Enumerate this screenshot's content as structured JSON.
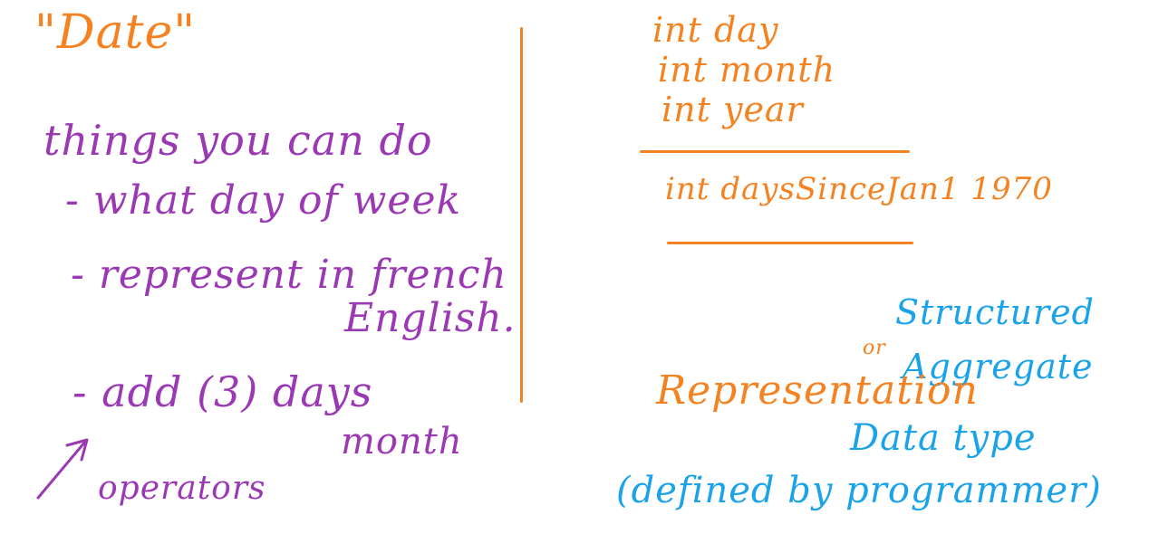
{
  "left_panel": {
    "title": "\"Date\"",
    "heading": "things you can do",
    "items": [
      "- what day of week",
      "- represent in french",
      "English.",
      "- add (3) days",
      "month"
    ],
    "arrow_label": "operators"
  },
  "right_panel": {
    "fields": [
      "int day",
      "int month",
      "int year"
    ],
    "alt_field": "int daysSinceJan1 1970"
  },
  "note": {
    "representation": "Representation",
    "or": "or",
    "structured": "Structured",
    "aggregate": "Aggregate",
    "data_type": "Data type",
    "defined_by": "(defined by programmer)"
  },
  "colors": {
    "orange": "#f58220",
    "purple": "#9b39b5",
    "blue": "#1aa3e8"
  }
}
